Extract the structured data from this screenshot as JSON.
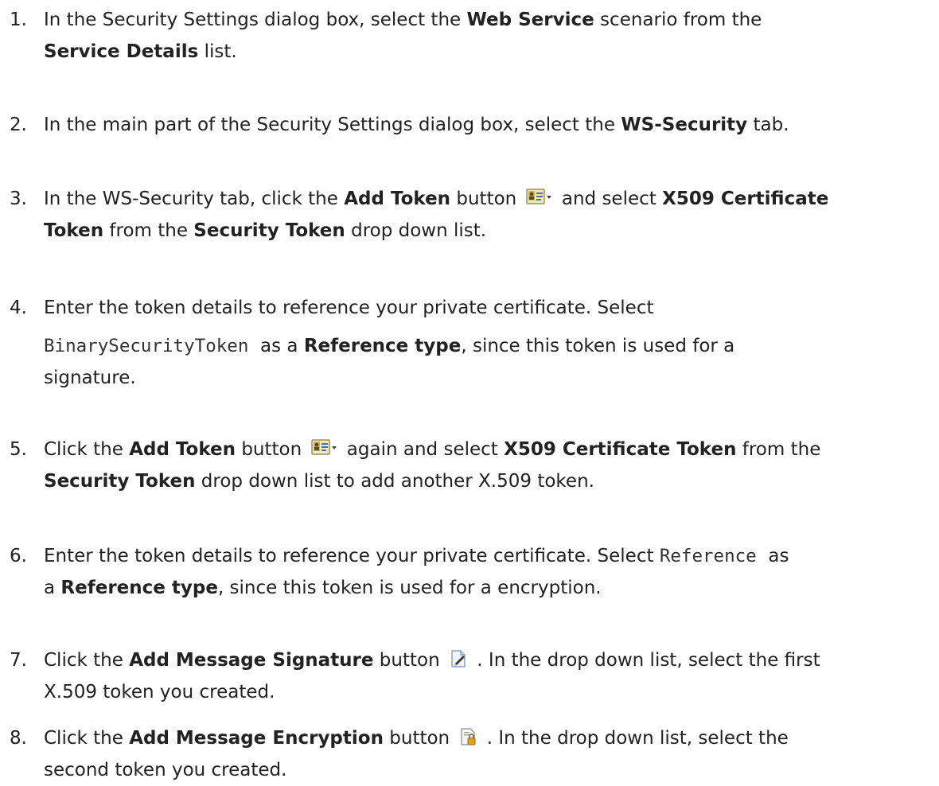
{
  "steps": [
    {
      "number": "1.",
      "lines": [
        [
          {
            "text": "In the Security Settings dialog box, select the "
          },
          {
            "text": "Web Service",
            "style": "bold"
          },
          {
            "text": " scenario from the"
          }
        ],
        [
          {
            "text": "Service Details",
            "style": "bold"
          },
          {
            "text": " list."
          }
        ]
      ]
    },
    {
      "number": "2.",
      "lines": [
        [
          {
            "text": "In the main part of the Security Settings dialog box, select the "
          },
          {
            "text": "WS-Security",
            "style": "bold"
          },
          {
            "text": " tab."
          }
        ]
      ]
    },
    {
      "number": "3.",
      "lines": [
        [
          {
            "text": "In the WS-Security tab, click the "
          },
          {
            "text": "Add Token",
            "style": "bold"
          },
          {
            "text": " button "
          },
          {
            "icon": "add-token-icon"
          },
          {
            "text": " and select "
          },
          {
            "text": "X509 Certificate",
            "style": "bold"
          }
        ],
        [
          {
            "text": "Token",
            "style": "bold"
          },
          {
            "text": " from the "
          },
          {
            "text": "Security Token",
            "style": "bold"
          },
          {
            "text": " drop down list."
          }
        ]
      ]
    },
    {
      "number": "4.",
      "lines": [
        [
          {
            "text": "Enter the token details to reference your private certificate. Select"
          }
        ],
        [
          {
            "text": "BinarySecurityToken",
            "style": "code"
          },
          {
            "text": "  as a "
          },
          {
            "text": "Reference type",
            "style": "bold"
          },
          {
            "text": ", since this token is used for a"
          }
        ],
        [
          {
            "text": "signature."
          }
        ]
      ]
    },
    {
      "number": "5.",
      "lines": [
        [
          {
            "text": "Click the "
          },
          {
            "text": "Add Token",
            "style": "bold"
          },
          {
            "text": " button "
          },
          {
            "icon": "add-token-icon"
          },
          {
            "text": " again and select "
          },
          {
            "text": "X509 Certificate Token",
            "style": "bold"
          },
          {
            "text": " from the"
          }
        ],
        [
          {
            "text": "Security Token",
            "style": "bold"
          },
          {
            "text": " drop down list to add another X.509 token."
          }
        ]
      ]
    },
    {
      "number": "6.",
      "lines": [
        [
          {
            "text": "Enter the token details to reference your private certificate. Select "
          },
          {
            "text": "Reference",
            "style": "code"
          },
          {
            "text": "  as"
          }
        ],
        [
          {
            "text": "a "
          },
          {
            "text": "Reference type",
            "style": "bold"
          },
          {
            "text": ", since this token is used for a encryption."
          }
        ]
      ]
    },
    {
      "number": "7.",
      "lines": [
        [
          {
            "text": "Click the "
          },
          {
            "text": "Add Message Signature",
            "style": "bold"
          },
          {
            "text": " button "
          },
          {
            "icon": "add-signature-icon"
          },
          {
            "text": " . In the drop down list, select the first"
          }
        ],
        [
          {
            "text": "X.509 token you created."
          }
        ]
      ]
    },
    {
      "number": "8.",
      "lines": [
        [
          {
            "text": "Click the "
          },
          {
            "text": "Add Message Encryption",
            "style": "bold"
          },
          {
            "text": " button "
          },
          {
            "icon": "add-encryption-icon"
          },
          {
            "text": " . In the drop down list, select the"
          }
        ],
        [
          {
            "text": "second token you created."
          }
        ]
      ]
    }
  ]
}
